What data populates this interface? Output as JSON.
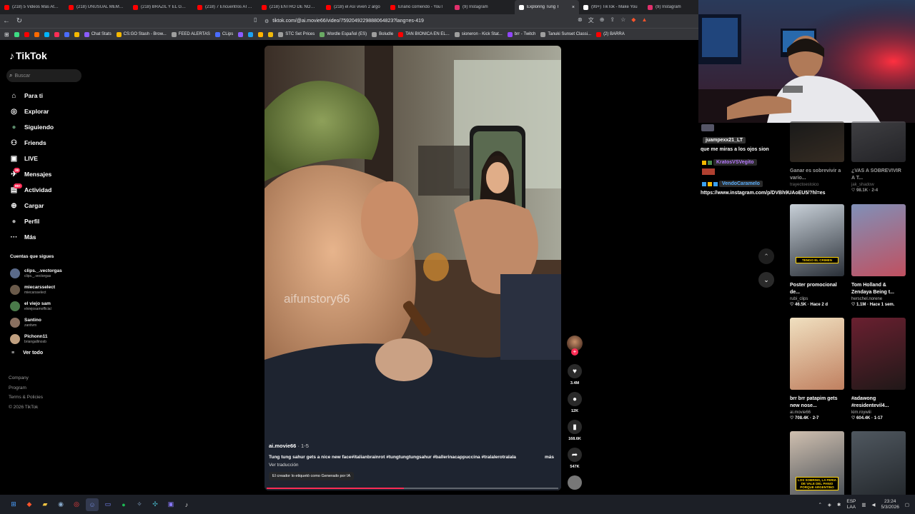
{
  "browser": {
    "tabs": [
      {
        "title": "(218) 5 Videos Más Atem",
        "color": "#ff0000",
        "active": false
      },
      {
        "title": "(218) UNUSUAL MEMES",
        "color": "#ff0000",
        "active": false
      },
      {
        "title": "(218) BRAZIL Y EL GORE",
        "color": "#ff0000",
        "active": false
      },
      {
        "title": "(218) 7 Encuentros ATER",
        "color": "#ff0000",
        "active": false
      },
      {
        "title": "(218) ENTRO DE NOCHE",
        "color": "#ff0000",
        "active": false
      },
      {
        "title": "(218) el Así viven 2 argo",
        "color": "#ff0000",
        "active": false
      },
      {
        "title": "Enano corriendo - YouT",
        "color": "#ff0000",
        "active": false
      },
      {
        "title": "(9) Instagram",
        "color": "#e1306c",
        "active": false
      },
      {
        "title": "Exploring Tung T",
        "color": "#ffffff",
        "active": true
      },
      {
        "title": "(99+) TikTok - Make You",
        "color": "#ffffff",
        "active": false
      },
      {
        "title": "(9) Instagram",
        "color": "#e1306c",
        "active": false
      }
    ],
    "url": "tiktok.com/@ai.movie66/video/7592049229888064823?lang=es-419",
    "bookmarks": [
      {
        "label": "",
        "color": "#3ddc84"
      },
      {
        "label": "",
        "color": "#ff0000"
      },
      {
        "label": "",
        "color": "#ff6a00"
      },
      {
        "label": "",
        "color": "#00b4ff"
      },
      {
        "label": "",
        "color": "#ff2d55"
      },
      {
        "label": "",
        "color": "#4a6cff"
      },
      {
        "label": "",
        "color": "#f5b800"
      },
      {
        "label": "Chat Stats",
        "color": "#8a5cff"
      },
      {
        "label": "CS:GO Stash - Brow...",
        "color": "#f5b800"
      },
      {
        "label": "FEED ALERTAS",
        "color": "#9e9e9e"
      },
      {
        "label": "CLips",
        "color": "#4a6cff"
      },
      {
        "label": "",
        "color": "#8a5cff"
      },
      {
        "label": "",
        "color": "#1da1f2"
      },
      {
        "label": "",
        "color": "#ffb300"
      },
      {
        "label": "",
        "color": "#f0b90b"
      },
      {
        "label": "STC Set Prices",
        "color": "#9e9e9e"
      },
      {
        "label": "Wordle Español (ES)",
        "color": "#6aaa64"
      },
      {
        "label": "Boludle",
        "color": "#9e9e9e"
      },
      {
        "label": "TAN BIONICA EN EL...",
        "color": "#ff0000"
      },
      {
        "label": "sioneron - Kick Stat...",
        "color": "#9e9e9e"
      },
      {
        "label": "brr - Twitch",
        "color": "#9146ff"
      },
      {
        "label": "Tanuki Sunset Classi...",
        "color": "#9e9e9e"
      },
      {
        "label": "(2) BARRA",
        "color": "#ff0000"
      }
    ]
  },
  "sidebar": {
    "logo": "TikTok",
    "search_placeholder": "Buscar",
    "nav": [
      {
        "label": "Para ti",
        "icon": "home-icon",
        "glyph": "⌂",
        "badge": ""
      },
      {
        "label": "Explorar",
        "icon": "compass-icon",
        "glyph": "◎",
        "badge": ""
      },
      {
        "label": "Siguiendo",
        "icon": "following-avatar-icon",
        "glyph": "●",
        "badge": ""
      },
      {
        "label": "Friends",
        "icon": "friends-icon",
        "glyph": "⚇",
        "badge": ""
      },
      {
        "label": "LIVE",
        "icon": "live-icon",
        "glyph": "▣",
        "badge": ""
      },
      {
        "label": "Mensajes",
        "icon": "messages-icon",
        "glyph": "✈",
        "badge": "38"
      },
      {
        "label": "Actividad",
        "icon": "activity-icon",
        "glyph": "▤",
        "badge": "99+"
      },
      {
        "label": "Cargar",
        "icon": "upload-icon",
        "glyph": "⊕",
        "badge": ""
      },
      {
        "label": "Perfil",
        "icon": "profile-icon",
        "glyph": "●",
        "badge": ""
      },
      {
        "label": "Más",
        "icon": "more-icon",
        "glyph": "···",
        "badge": ""
      }
    ],
    "following_title": "Cuentas que sigues",
    "following": [
      {
        "name": "clips._.vectorgas",
        "handle": "clips._.vectorgas",
        "color": "#5a6a8a"
      },
      {
        "name": "miecarsselect",
        "handle": "miecarsselect",
        "color": "#6a5a4a"
      },
      {
        "name": "el viejo sam",
        "handle": "elviejosamofficial",
        "color": "#4a7a4a"
      },
      {
        "name": "Santino",
        "handle": "zantivm",
        "color": "#8a7060"
      },
      {
        "name": "Pichonn11",
        "handle": "briangallinosb",
        "color": "#c0a080"
      }
    ],
    "see_all": "Ver todo",
    "footer": [
      "Company",
      "Program",
      "Terms & Policies",
      "© 2026 TikTok"
    ]
  },
  "video": {
    "watermark": "aifunstory66",
    "author": "ai.movie66",
    "date": " · 1-5",
    "caption": "Tung tung sahur gets a nice new face#italianbrainrot #tungtungtungsahur #ballerinacappuccina #tralalerotralala",
    "more": "más",
    "translate": "Ver traducción",
    "ai_label": "El creador lo etiquetó como Generado por IA",
    "progress": 0.47,
    "likes": "3.4M",
    "comments": "12K",
    "saves": "168.6K",
    "shares": "547K"
  },
  "chat": {
    "user1": "juampexx21_LT",
    "msg1": "que me miras a los ojos sion",
    "user2": "KratosVSVegito",
    "user3": "VendoCaramelo",
    "msg3": "https://www.instagram.com/p/DVBh9UAoEU5/?hl=es"
  },
  "recommendations": [
    {
      "title": "Ganar es sobrevivir a vario...",
      "author": "trayectoestoico",
      "stats": "",
      "colors": [
        "#2a2a2a",
        "#5a4a3a"
      ],
      "faded": true
    },
    {
      "title": "¿VAS A SOBREVIVIR A T...",
      "author": "jak_shadow",
      "stats": "♡ 98.1K · 2-4",
      "colors": [
        "#6a6a70",
        "#3a3a40"
      ],
      "faded": true
    },
    {
      "title": "Poster promocional de...",
      "author": "rubi_clips",
      "stats": "♡ 46.5K · Hace 2 d",
      "colors": [
        "#c8d0d8",
        "#2a3038"
      ],
      "faded": false
    },
    {
      "title": "Tom Holland & Zendaya Being t...",
      "author": "herschel.norene",
      "stats": "♡ 1.1M · Hace 1 sem.",
      "colors": [
        "#8090b8",
        "#c05060"
      ],
      "faded": false
    },
    {
      "title": "brr brr patapim gets new nose...",
      "author": "ai.movie66",
      "stats": "♡ 708.4K · 2-7",
      "colors": [
        "#f0e0c0",
        "#c08060"
      ],
      "faded": false
    },
    {
      "title": "#adawong #residentevil4...",
      "author": "kim.roywiii",
      "stats": "♡ 604.4K · 1-17",
      "colors": [
        "#6a2030",
        "#201818"
      ],
      "faded": false
    },
    {
      "title": "",
      "author": "",
      "stats": "",
      "colors": [
        "#d0c0b0",
        "#404850"
      ],
      "faded": false
    },
    {
      "title": "",
      "author": "",
      "stats": "",
      "colors": [
        "#505860",
        "#202428"
      ],
      "faded": false
    }
  ],
  "rec_thumb_texts": [
    "",
    "",
    "TENGO EL CRIMEN",
    "",
    "",
    "",
    "LOS SOBRINS, LA FERIA DE VALE DEL PANIO PORQUE ARGENTINO",
    ""
  ],
  "taskbar": {
    "lang1": "ESP",
    "lang2": "LAA",
    "time": "23:24",
    "date": "5/3/2026"
  },
  "colors": {
    "tiktok_red": "#fe2c55",
    "background": "#000000"
  }
}
